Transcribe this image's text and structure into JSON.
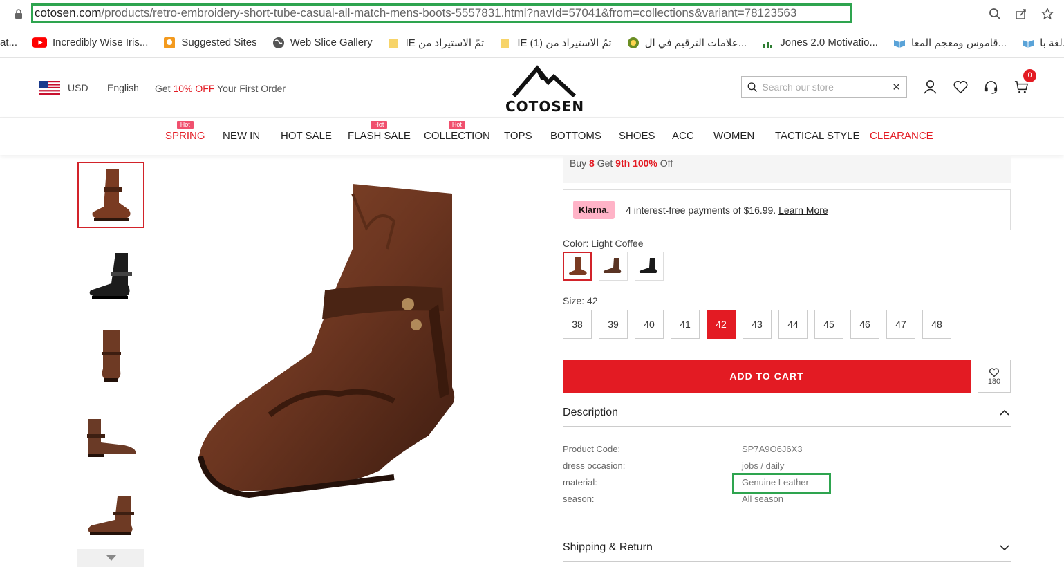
{
  "browser": {
    "url_host": "cotosen.com",
    "url_path": "/products/retro-embroidery-short-tube-casual-all-match-mens-boots-5557831.html?navId=57041&from=collections&variant=78123563",
    "icons": [
      "zoom-icon",
      "share-icon",
      "star-icon"
    ]
  },
  "bookmarks": [
    {
      "label": "at...",
      "icon": "blank"
    },
    {
      "label": "Incredibly Wise Iris...",
      "icon": "youtube"
    },
    {
      "label": "Suggested Sites",
      "icon": "orange"
    },
    {
      "label": "Web Slice Gallery",
      "icon": "globe"
    },
    {
      "label": "IE تمّ الاستيراد من",
      "icon": "folder"
    },
    {
      "label": "IE (1) تمّ الاستيراد من",
      "icon": "folder"
    },
    {
      "label": "علامات الترقيم في ال...",
      "icon": "site"
    },
    {
      "label": "Jones 2.0 Motivatio...",
      "icon": "site"
    },
    {
      "label": "قاموس ومعجم المعا...",
      "icon": "book"
    },
    {
      "label": "لغة با...",
      "icon": "book"
    }
  ],
  "header": {
    "currency": "USD",
    "language": "English",
    "promo_prefix": "Get ",
    "promo_highlight": "10% OFF",
    "promo_suffix": " Your First Order",
    "logo_text": "COTOSEN",
    "search_placeholder": "Search our store",
    "cart_count": "0"
  },
  "nav": [
    {
      "label": "SPRING",
      "hot": true,
      "red": true
    },
    {
      "label": "NEW IN",
      "hot": false,
      "red": false
    },
    {
      "label": "HOT SALE",
      "hot": false,
      "red": false
    },
    {
      "label": "FLASH SALE",
      "hot": true,
      "red": false
    },
    {
      "label": "COLLECTION",
      "hot": true,
      "red": false
    },
    {
      "label": "TOPS",
      "hot": false,
      "red": false
    },
    {
      "label": "BOTTOMS",
      "hot": false,
      "red": false
    },
    {
      "label": "SHOES",
      "hot": false,
      "red": false
    },
    {
      "label": "ACC",
      "hot": false,
      "red": false
    },
    {
      "label": "WOMEN",
      "hot": false,
      "red": false
    },
    {
      "label": "TACTICAL STYLE",
      "hot": false,
      "red": false
    },
    {
      "label": "CLEARANCE",
      "hot": false,
      "red": true
    }
  ],
  "hot_tag": "Hot",
  "offer": {
    "buy": "Buy",
    "n1": "8",
    "get": "Get",
    "n2": "9th",
    "pct": "100%",
    "off": "Off"
  },
  "klarna": {
    "logo": "Klarna.",
    "text": "4 interest-free payments of $16.99.",
    "link": "Learn More"
  },
  "product": {
    "color_label": "Color: Light Coffee",
    "size_label": "Size: 42",
    "sizes": [
      "38",
      "39",
      "40",
      "41",
      "42",
      "43",
      "44",
      "45",
      "46",
      "47",
      "48"
    ],
    "selected_size": "42",
    "add_to_cart": "ADD TO CART",
    "wishlist_count": "180"
  },
  "description": {
    "title": "Description",
    "specs": [
      {
        "key": "Product Code:",
        "value": "SP7A9O6J6X3"
      },
      {
        "key": "dress occasion:",
        "value": "jobs / daily"
      },
      {
        "key": "material:",
        "value": "Genuine Leather"
      },
      {
        "key": "season:",
        "value": "All season"
      }
    ]
  },
  "shipping": {
    "title": "Shipping & Return"
  },
  "colors": {
    "brand_red": "#e31b23",
    "highlight_green": "#2ea44f"
  }
}
